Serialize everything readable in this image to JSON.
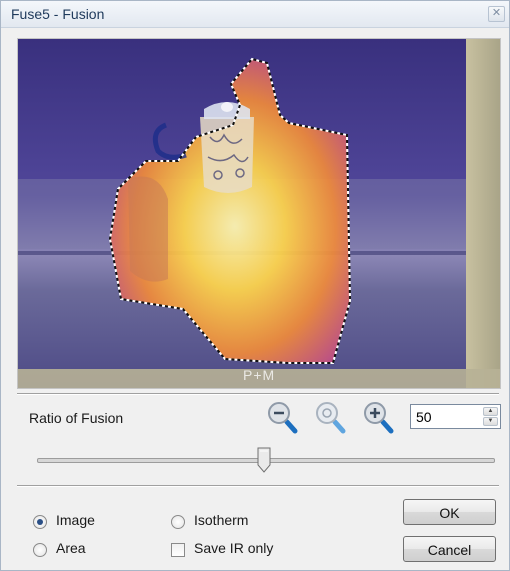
{
  "window": {
    "title": "Fuse5 - Fusion",
    "close_glyph": "✕"
  },
  "viewport": {
    "caption_fragment": "P+M"
  },
  "fusion": {
    "ratio_label": "Ratio of Fusion",
    "ratio_value": "50",
    "slider_level_percent": 50,
    "zoom_icons": [
      "zoom-out-icon",
      "zoom-reset-icon",
      "zoom-in-icon"
    ]
  },
  "mode": {
    "image_label": "Image",
    "area_label": "Area",
    "isotherm_label": "Isotherm",
    "save_ir_only_label": "Save IR only",
    "selected": "Image",
    "save_ir_only_checked": false
  },
  "buttons": {
    "ok_label": "OK",
    "cancel_label": "Cancel"
  },
  "colors": {
    "accent": "#2a6fc0",
    "title_text": "#1e395b"
  }
}
